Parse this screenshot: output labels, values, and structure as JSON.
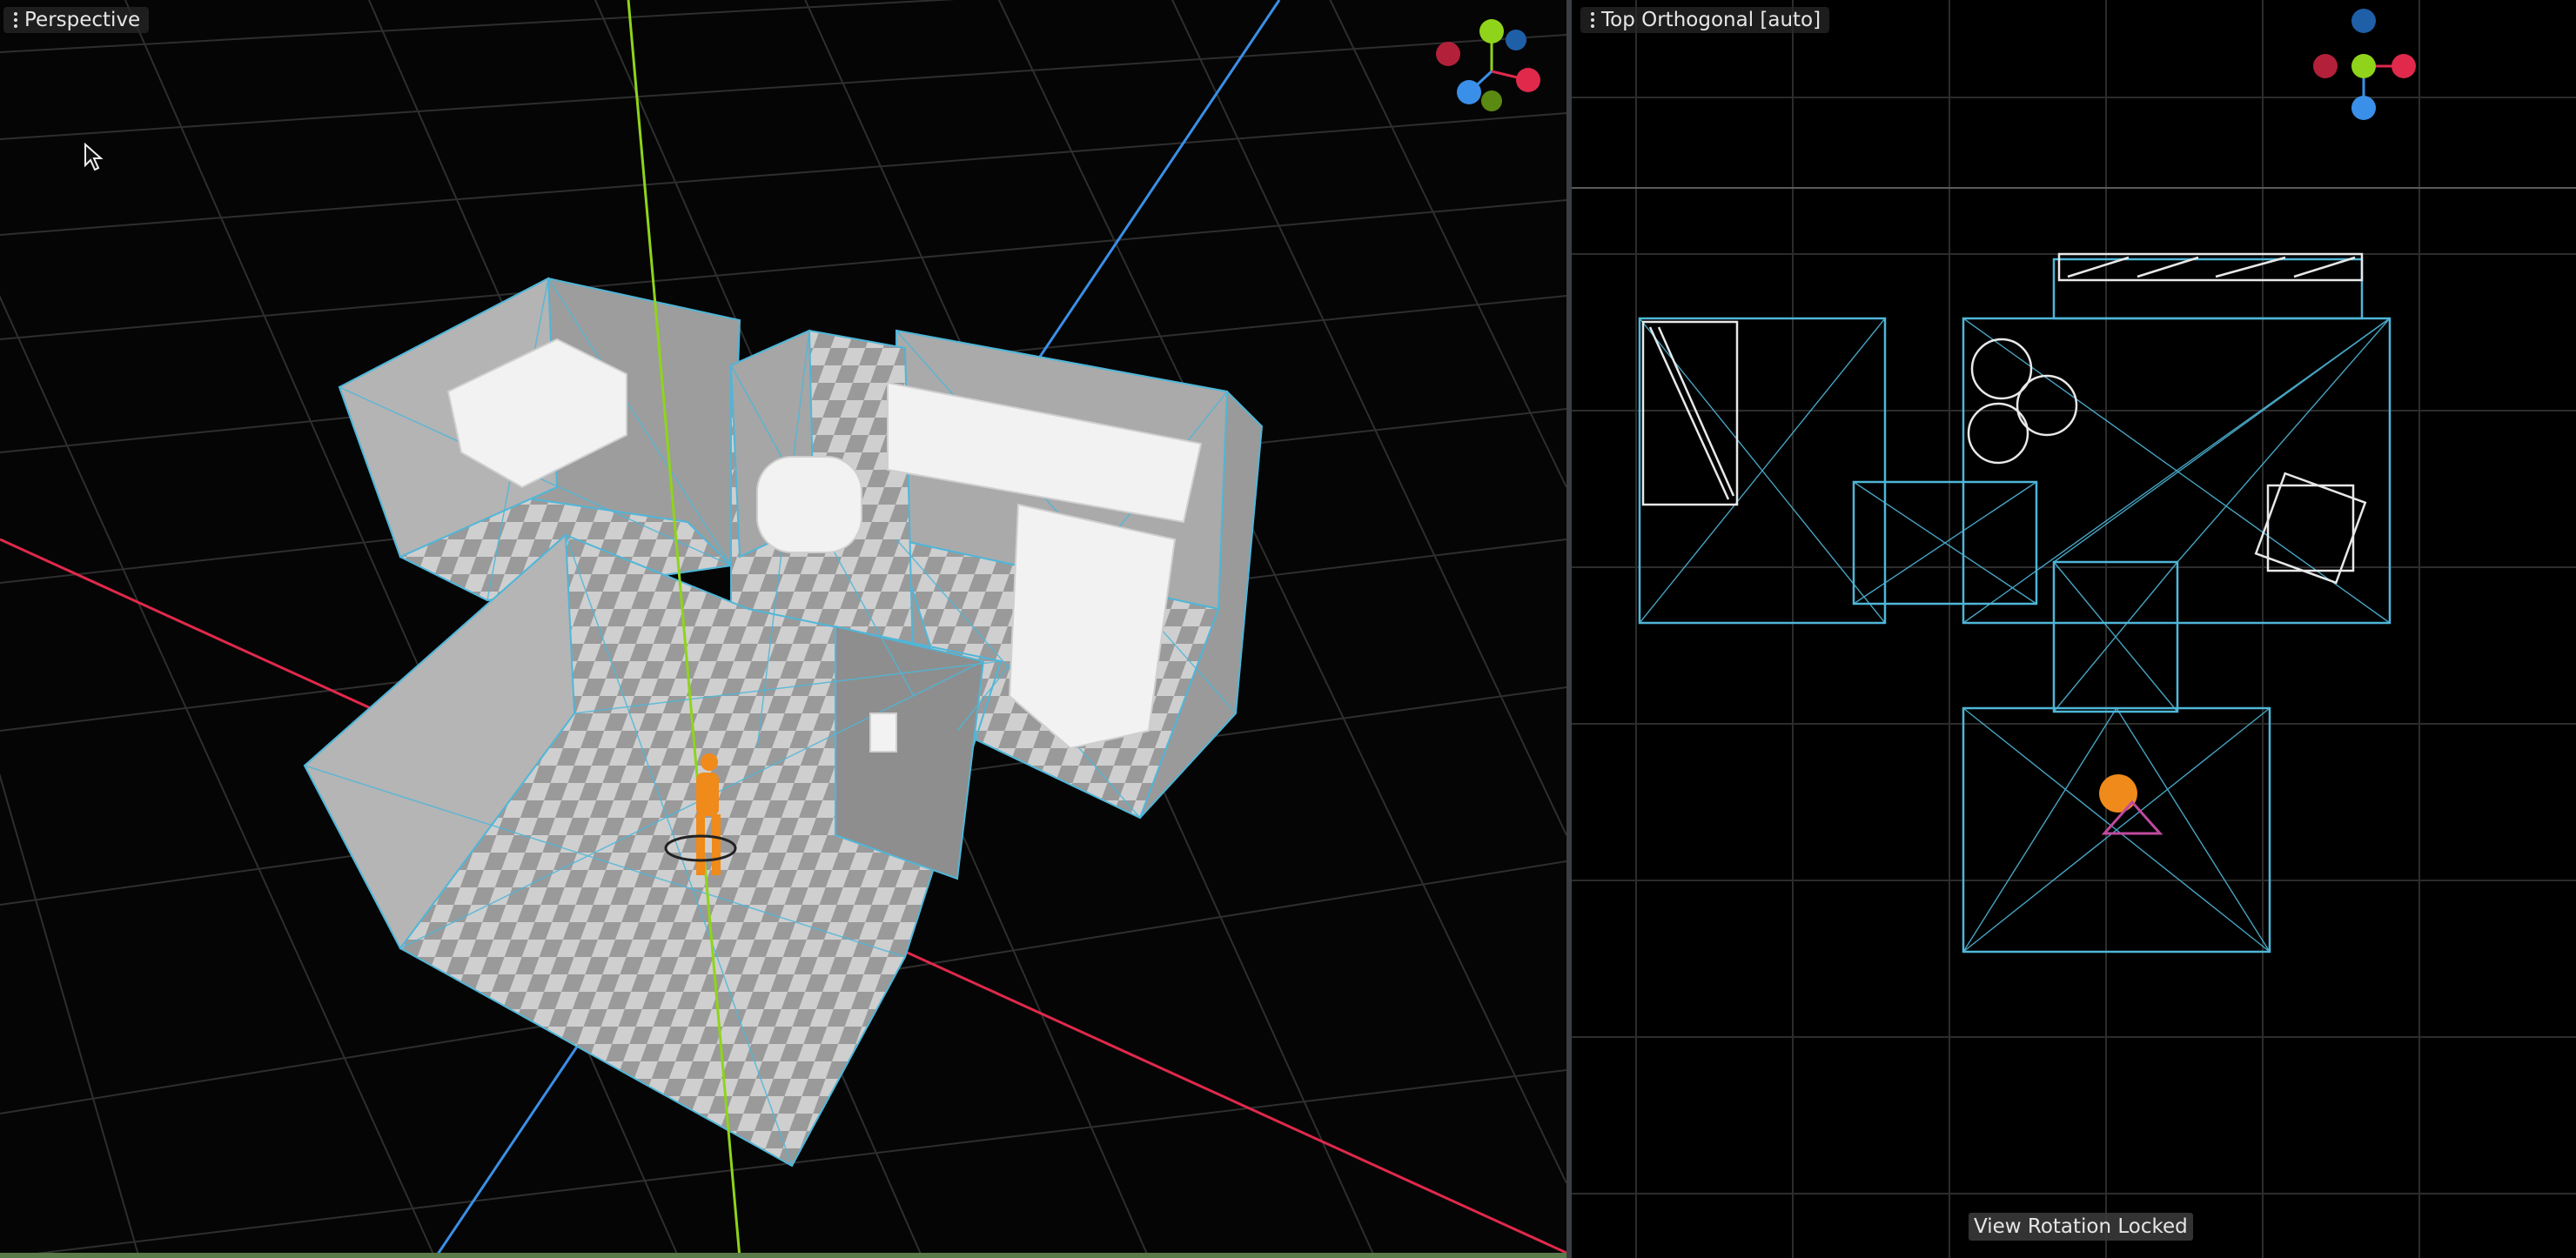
{
  "viewports": {
    "perspective": {
      "title": "Perspective",
      "gizmo": {
        "y": "Y",
        "x": "X",
        "z": "Z"
      }
    },
    "top": {
      "title": "Top Orthogonal [auto]",
      "gizmo": {
        "y": "Y",
        "x": "X",
        "z": "Z"
      }
    }
  },
  "status": {
    "view_rotation": "View Rotation Locked"
  },
  "colors": {
    "axis_x": "#e0294b",
    "axis_y": "#8fd41a",
    "axis_z": "#3a8fe8",
    "navmesh": "#4fb6d8",
    "grid": "#3a3a3a",
    "character": "#f08a1a"
  }
}
